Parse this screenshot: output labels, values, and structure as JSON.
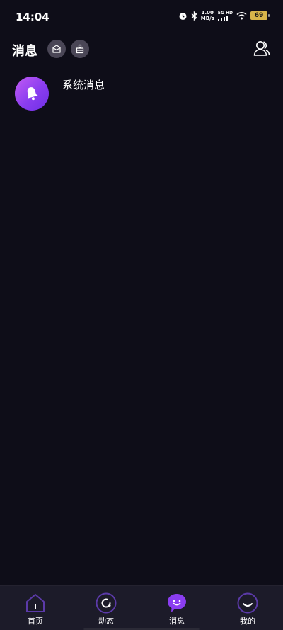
{
  "status": {
    "time": "14:04",
    "speed_value": "1.00",
    "speed_unit": "MB/s",
    "network": "5G HD",
    "battery": "69"
  },
  "header": {
    "title": "消息"
  },
  "messages": [
    {
      "title": "系统消息",
      "icon": "bell-icon"
    }
  ],
  "tabbar": {
    "tabs": [
      {
        "label": "首页",
        "icon": "home-icon"
      },
      {
        "label": "动态",
        "icon": "activity-icon"
      },
      {
        "label": "消息",
        "icon": "chat-bubble-icon",
        "active": true
      },
      {
        "label": "我的",
        "icon": "profile-icon"
      }
    ]
  },
  "colors": {
    "background": "#0e0d18",
    "tabbar": "#1c1b29",
    "accent": "#8a3df0",
    "tab_outline": "#5b3aa8"
  }
}
